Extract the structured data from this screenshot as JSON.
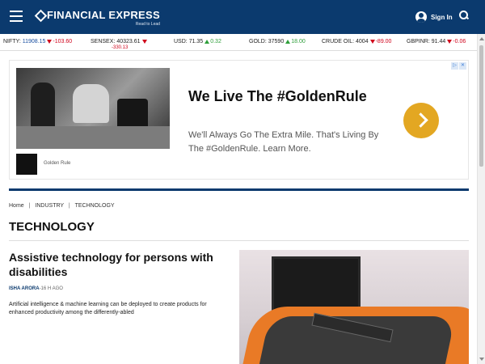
{
  "header": {
    "brand": "FINANCIAL EXPRESS",
    "tagline": "Read to Lead",
    "signin": "Sign In",
    "bg_color": "#0b3a6e"
  },
  "ticker": {
    "nifty": {
      "label": "NIFTY:",
      "value": "11908.15",
      "change": "-103.60"
    },
    "sensex": {
      "label": "SENSEX:",
      "value": "40323.61",
      "change": "-330.13"
    },
    "usd": {
      "label": "USD:",
      "value": "71.35",
      "change": "0.32"
    },
    "gold": {
      "label": "GOLD:",
      "value": "37590",
      "change": "18.00"
    },
    "crude": {
      "label": "CRUDE OIL:",
      "value": "4004",
      "change": "-89.00"
    },
    "gbpinr": {
      "label": "GBPINR:",
      "value": "91.44",
      "change": "-0.06"
    }
  },
  "ad": {
    "close_a": "▷",
    "close_b": "✕",
    "logo_text": "Golden Rule",
    "headline": "We Live The #GoldenRule",
    "body": "We'll Always Go The Extra Mile. That's Living By The #GoldenRule. Learn More.",
    "cta_color": "#e3a722"
  },
  "breadcrumb": {
    "items": [
      "Home",
      "INDUSTRY",
      "TECHNOLOGY"
    ],
    "separator": "|"
  },
  "page_title": "TECHNOLOGY",
  "article": {
    "title": "Assistive technology for persons with disabilities",
    "author": "ISHA ARORA",
    "time": "-16 H AGO",
    "summary": "Artificial intelligence & machine learning can be deployed to create products for enhanced productivity among the differently-abled"
  }
}
